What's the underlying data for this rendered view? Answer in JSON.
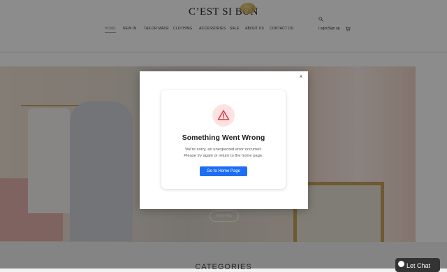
{
  "header": {
    "logo": "C’EST SI BON",
    "nav": [
      {
        "label": "HOME",
        "active": true
      },
      {
        "label": "NEW IN",
        "active": false
      },
      {
        "label": "TAILOR MADE",
        "active": false
      },
      {
        "label": "CLOTHING",
        "active": false
      },
      {
        "label": "ACCESSORIES",
        "active": false
      },
      {
        "label": "SALE",
        "active": false
      },
      {
        "label": "ABOUT US",
        "active": false
      },
      {
        "label": "CONTACT US",
        "active": false
      }
    ],
    "login": "Login/Sign up",
    "search_icon": "search-icon",
    "cart_icon": "cart-icon"
  },
  "hero": {
    "button": "Shop Now"
  },
  "sections": {
    "categories": "CATEGORIES"
  },
  "chat": {
    "label": "Let Chat"
  },
  "modal": {
    "close": "×",
    "title": "Something Went Wrong",
    "message_line1": "We're sorry, an unexpected error occurred.",
    "message_line2": "Please try again or return to the home page.",
    "button": "Go to Home Page",
    "icon": "warning-icon",
    "colors": {
      "accent": "#1d6ef5",
      "warning": "#e0343b",
      "warning_bg": "#fde2e2"
    }
  }
}
